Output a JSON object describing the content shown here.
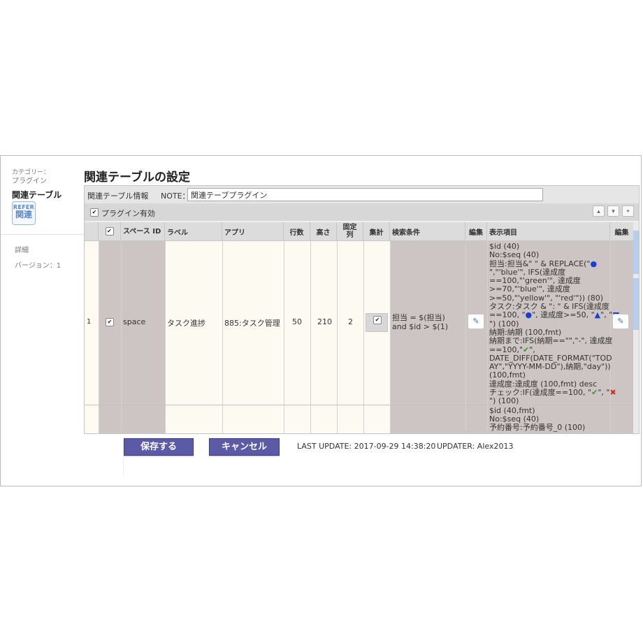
{
  "sidebar": {
    "category_label": "カテゴリー：",
    "category_value": "プラグイン",
    "plugin_name": "関連テーブル",
    "logo_top": "REFER",
    "logo_bottom": "関連",
    "detail_link": "詳細",
    "version": "バージョン：1"
  },
  "main": {
    "title": "関連テーブルの設定",
    "info_label": "関連テーブル情報",
    "note_label": "NOTE：",
    "note_value": "関連テーブプラグイン",
    "plugin_enabled_label": "プラグイン有効",
    "toolbar": {
      "up": "▴",
      "down": "▾",
      "pin": "⌖"
    }
  },
  "table": {
    "headers": {
      "space_id": "スペース ID",
      "label": "ラベル",
      "app": "アプリ",
      "rows": "行数",
      "height": "高さ",
      "fixed_col": "固定列",
      "sum": "集計",
      "search": "検索条件",
      "edit": "編集",
      "display": "表示項目",
      "edit2": "編集"
    },
    "row1": {
      "index": "1",
      "space": "space",
      "label": "タスク進捗",
      "app": "885:タスク管理",
      "rows": "50",
      "height": "210",
      "fixed": "2",
      "cond_line1": "担当 = $(担当)",
      "cond_line2": "and $id > $(1)",
      "display_lines": [
        "$id (40)",
        "No:$seq (40)",
        "担当:担当&\" \" & REPLACE(\"●",
        "\",\"'blue'\", IFS(達成度",
        "==100,\"'green'\", 達成度",
        ">=70,\"'blue'\", 達成度",
        ">=50,\"'yellow'\", \"'red'\")) (80)",
        "タスク:タスク & \": \" & IFS(達成度",
        "==100, \"●\", 達成度>=50, \"▲\", \"■",
        "\") (100)",
        "納期:納期 (100,fmt)",
        "納期まで:IFS(納期==\"\",\"-\", 達成度",
        "==100,\"✔\",",
        "DATE_DIFF(DATE_FORMAT(\"TOD",
        "AY\",\"YYYY-MM-DD\"),納期,\"day\"))",
        "(100,fmt)",
        "達成度:達成度 (100,fmt) desc",
        "チェック:IF(達成度==100, \"✔\", \"✖",
        "\") (100)"
      ]
    },
    "row2": {
      "display_lines": [
        "$id (40,fmt)",
        "No:$seq (40)",
        "予約番号:予約番号_0 (100)"
      ]
    }
  },
  "footer": {
    "save": "保存する",
    "cancel": "キャンセル",
    "last_update": "LAST UPDATE: 2017-09-29 14:38:20",
    "updater": "UPDATER: Alex2013"
  }
}
